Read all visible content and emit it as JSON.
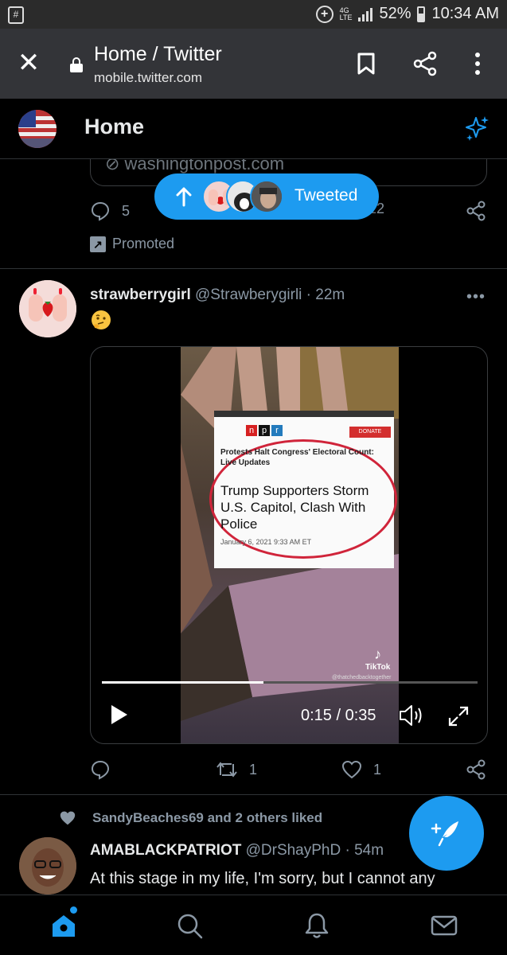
{
  "status_bar": {
    "battery_percent": "52%",
    "time": "10:34 AM",
    "network": "LTE",
    "data_badge": "4G"
  },
  "browser": {
    "title": "Home / Twitter",
    "url": "mobile.twitter.com"
  },
  "header": {
    "title": "Home"
  },
  "previous_tweet": {
    "link_domain": "washingtonpost.com",
    "reply_count": "5",
    "like_count": "12",
    "promoted_label": "Promoted"
  },
  "new_tweets_pill": {
    "label": "Tweeted"
  },
  "tweet": {
    "display_name": "strawberrygirl",
    "handle": "@Strawberygirli",
    "time": "· 22m",
    "emoji": "🤔",
    "video": {
      "npr_subheadline": "Protests Halt Congress' Electoral Count: Live Updates",
      "npr_headline": "Trump Supporters Storm U.S. Capitol, Clash With Police",
      "npr_date": "January 6, 2021  9:33 AM ET",
      "npr_logo": [
        "n",
        "p",
        "r"
      ],
      "npr_donate": "DONATE",
      "tiktok_label": "TikTok",
      "tiktok_handle": "@thatchedbacktogether",
      "time_display": "0:15 / 0:35",
      "progress_fraction": 0.43
    },
    "reply_count": "",
    "retweet_count": "1",
    "like_count": "1"
  },
  "next_tweet": {
    "social_context": "SandyBeaches69 and 2 others liked",
    "display_name": "AMABLACKPATRIOT",
    "handle": "@DrShayPhD",
    "time": "· 54m",
    "text": "At this stage in my life, I'm sorry, but I cannot any"
  },
  "icons": {
    "close": "close-icon",
    "lock": "lock-icon",
    "bookmark": "bookmark-icon",
    "share": "share-icon",
    "more": "more-vertical-icon",
    "sparkle": "sparkle-icon",
    "compose": "compose-feather-icon",
    "home": "home-icon",
    "search": "search-icon",
    "notifications": "bell-icon",
    "messages": "mail-icon"
  },
  "colors": {
    "accent": "#1d9bf0",
    "background": "#000000",
    "browser_bar": "#333438",
    "muted_text": "#8b98a5"
  }
}
